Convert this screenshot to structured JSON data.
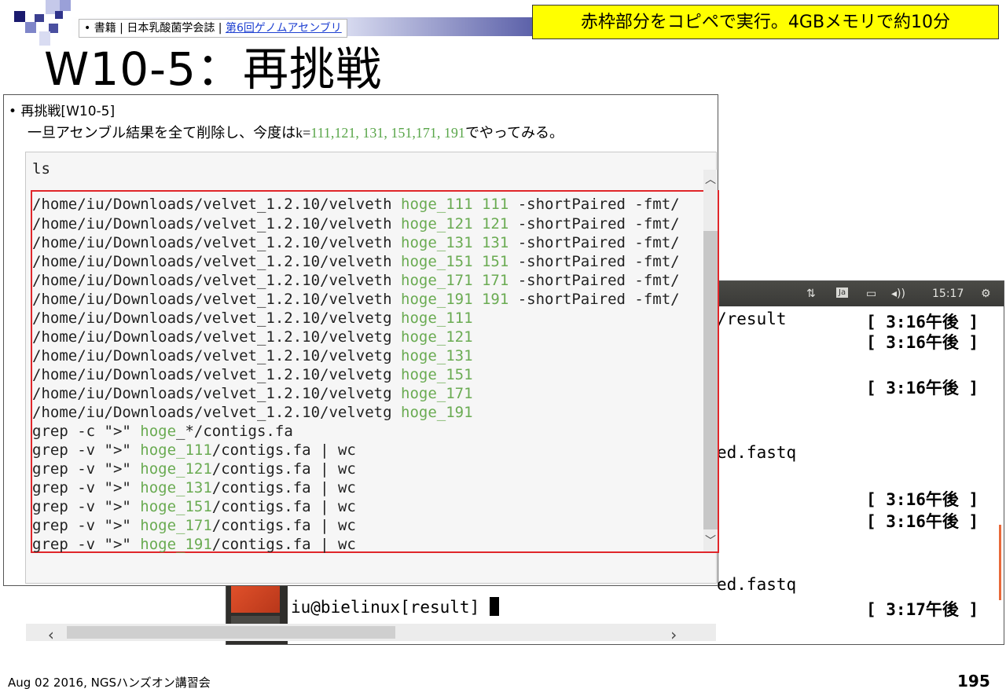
{
  "header": {
    "bullet": "•",
    "breadcrumb_prefix": "書籍 | 日本乳酸菌学会誌 | ",
    "breadcrumb_link": "第6回ゲノムアセンブリ",
    "note": "赤枠部分をコピペで実行。4GBメモリで約10分"
  },
  "slide": {
    "title": "W10-5：再挑戦"
  },
  "document": {
    "bullet_text": "• 再挑戦[W10-5]",
    "desc_prefix": "一旦アセンブル結果を全て削除し、今度は",
    "desc_k": "k=",
    "desc_values": "111,121, 131, 151,171, 191",
    "desc_suffix": "でやってみる。",
    "code_lines": [
      {
        "pre": "ls",
        "g": "",
        "post": ""
      },
      {
        "pre": "/home/iu/Downloads/velvet_1.2.10/velveth ",
        "g": "hoge_111 111",
        "post": " -shortPaired -fmt/"
      },
      {
        "pre": "/home/iu/Downloads/velvet_1.2.10/velveth ",
        "g": "hoge_121 121",
        "post": " -shortPaired -fmt/"
      },
      {
        "pre": "/home/iu/Downloads/velvet_1.2.10/velveth ",
        "g": "hoge_131 131",
        "post": " -shortPaired -fmt/"
      },
      {
        "pre": "/home/iu/Downloads/velvet_1.2.10/velveth ",
        "g": "hoge_151 151",
        "post": " -shortPaired -fmt/"
      },
      {
        "pre": "/home/iu/Downloads/velvet_1.2.10/velveth ",
        "g": "hoge_171 171",
        "post": " -shortPaired -fmt/"
      },
      {
        "pre": "/home/iu/Downloads/velvet_1.2.10/velveth ",
        "g": "hoge_191 191",
        "post": " -shortPaired -fmt/"
      },
      {
        "pre": "/home/iu/Downloads/velvet_1.2.10/velvetg ",
        "g": "hoge_111",
        "post": ""
      },
      {
        "pre": "/home/iu/Downloads/velvet_1.2.10/velvetg ",
        "g": "hoge_121",
        "post": ""
      },
      {
        "pre": "/home/iu/Downloads/velvet_1.2.10/velvetg ",
        "g": "hoge_131",
        "post": ""
      },
      {
        "pre": "/home/iu/Downloads/velvet_1.2.10/velvetg ",
        "g": "hoge_151",
        "post": ""
      },
      {
        "pre": "/home/iu/Downloads/velvet_1.2.10/velvetg ",
        "g": "hoge_171",
        "post": ""
      },
      {
        "pre": "/home/iu/Downloads/velvet_1.2.10/velvetg ",
        "g": "hoge_191",
        "post": ""
      },
      {
        "pre": "grep -c \">\" ",
        "g": "hoge",
        "post": "_*/contigs.fa"
      },
      {
        "pre": "grep -v \">\" ",
        "g": "hoge_111",
        "post": "/contigs.fa | wc"
      },
      {
        "pre": "grep -v \">\" ",
        "g": "hoge_121",
        "post": "/contigs.fa | wc"
      },
      {
        "pre": "grep -v \">\" ",
        "g": "hoge_131",
        "post": "/contigs.fa | wc"
      },
      {
        "pre": "grep -v \">\" ",
        "g": "hoge_151",
        "post": "/contigs.fa | wc"
      },
      {
        "pre": "grep -v \">\" ",
        "g": "hoge_171",
        "post": "/contigs.fa | wc"
      },
      {
        "pre": "grep -v \">\" ",
        "g": "hoge_191",
        "post": "/contigs.fa | wc"
      }
    ]
  },
  "terminal": {
    "clock": "15:17",
    "input_indicator": "Ja",
    "lines": [
      {
        "text": "/result",
        "time": "[ 3:16午後 ]"
      },
      {
        "text": "",
        "time": "[ 3:16午後 ]"
      },
      {
        "text": "",
        "time": "[ 3:16午後 ]"
      },
      {
        "text": "ed.fastq",
        "time": ""
      },
      {
        "text": "",
        "time": "[ 3:16午後 ]"
      },
      {
        "text": "",
        "time": "[ 3:16午後 ]"
      },
      {
        "text": "ed.fastq",
        "time": ""
      },
      {
        "text": "iu@bielinux[result] ",
        "time": "[ 3:17午後 ]"
      }
    ]
  },
  "footer": {
    "left": "Aug 02 2016, NGSハンズオン講習会",
    "page": "195"
  }
}
